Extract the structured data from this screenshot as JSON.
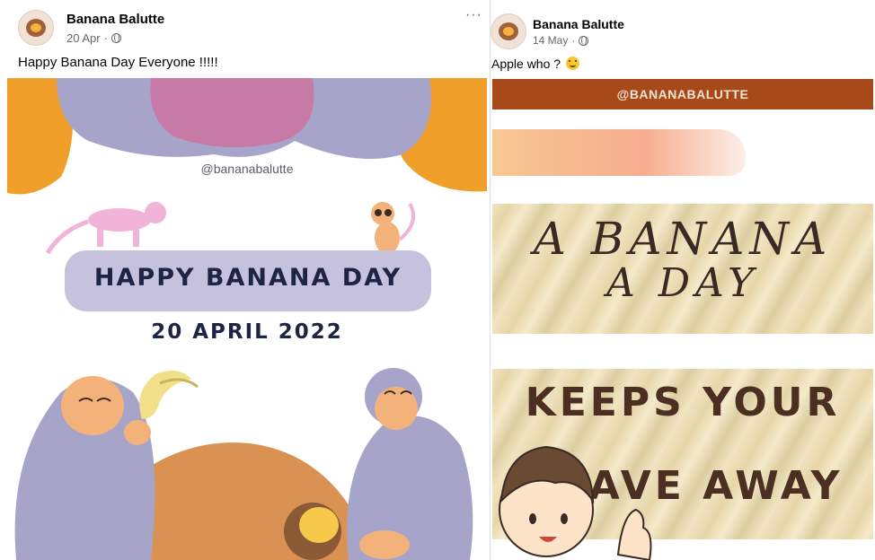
{
  "posts": [
    {
      "author": "Banana Balutte",
      "date": "20 Apr",
      "separator": "·",
      "caption": "Happy Banana Day Everyone !!!!!",
      "more_label": "···",
      "image": {
        "handle": "@bananabalutte",
        "title": "HAPPY BANANA DAY",
        "date": "20 APRIL 2022"
      }
    },
    {
      "author": "Banana Balutte",
      "date": "14 May",
      "separator": "·",
      "caption": "Apple who ?",
      "caption_emoji": "grinning-face-emoji",
      "image": {
        "handle": "@BANANABALUTTE",
        "script_line1": "A BANANA",
        "script_line2": "A DAY",
        "bold_line1": "KEEPS YOUR",
        "bold_line2": "CRAVE AWAY"
      }
    }
  ],
  "colors": {
    "orange": "#f0a02a",
    "lavender": "#a7a4c9",
    "pink": "#c77aa6",
    "navy_text": "#1d2444",
    "brown_bar": "#a8491a",
    "meta_gray": "#65676b"
  }
}
